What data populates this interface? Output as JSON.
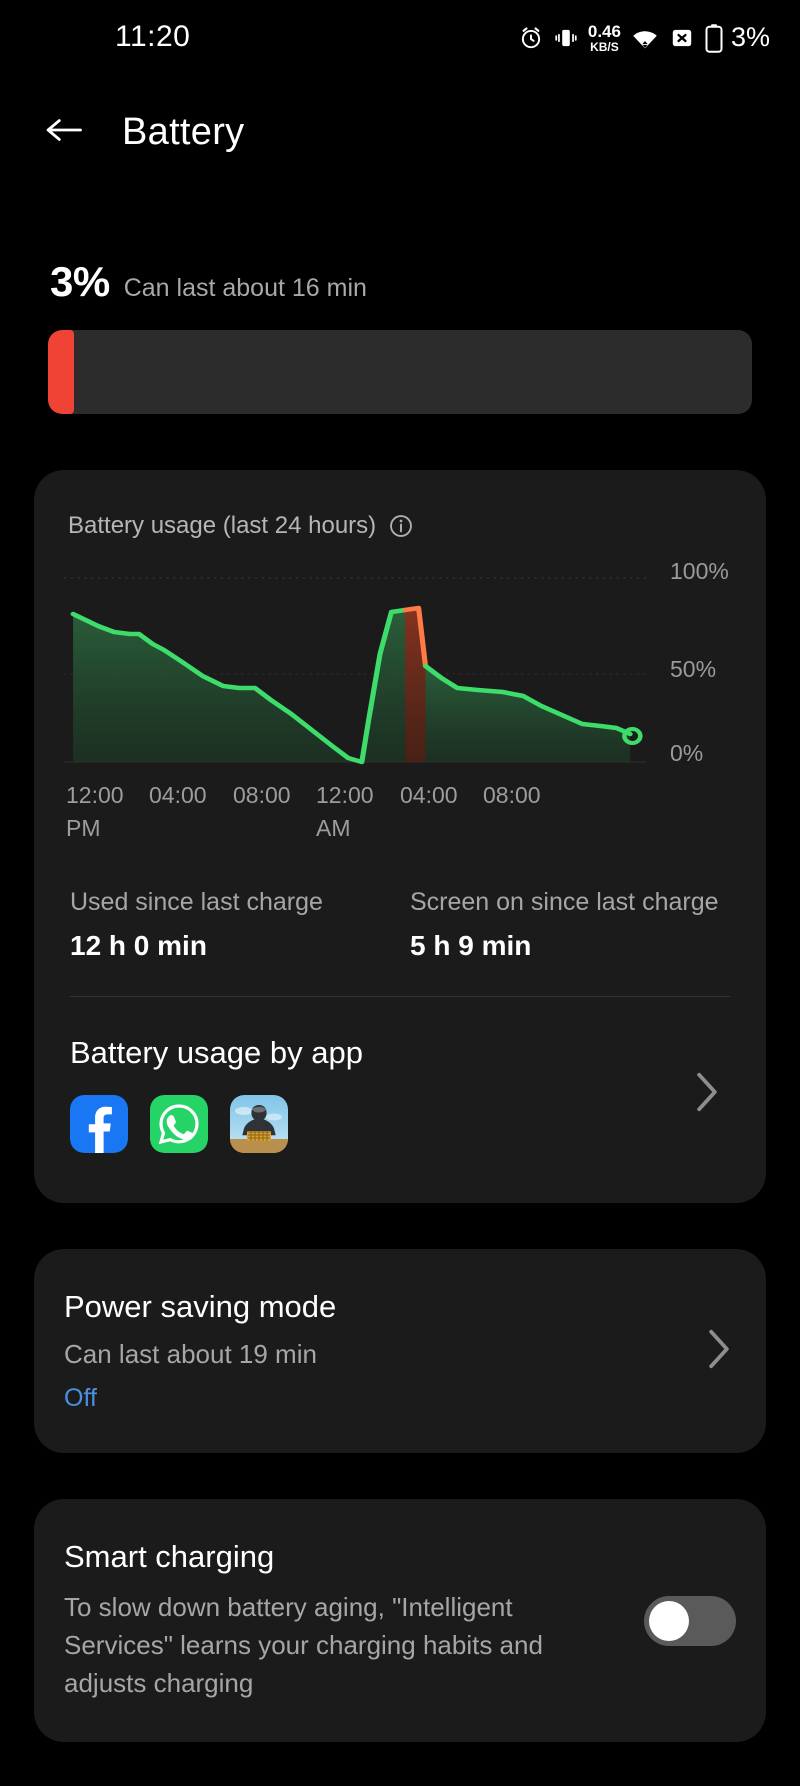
{
  "statusbar": {
    "time": "11:20",
    "netspeed_value": "0.46",
    "netspeed_unit": "KB/S",
    "battery_percent": "3%",
    "icons": [
      "alarm-icon",
      "vibrate-icon",
      "wifi-icon",
      "sim-disabled-icon",
      "battery-icon"
    ]
  },
  "appbar": {
    "back": "back-arrow-icon",
    "title": "Battery"
  },
  "summary": {
    "percent": "3%",
    "estimate": "Can last about 16 min",
    "bar_fill_percent": 3,
    "bar_fill_color": "#ef4335",
    "bar_track_color": "#2c2c2c"
  },
  "usage_card": {
    "title": "Battery usage (last 24 hours)",
    "info_icon": "info-icon",
    "stats": [
      {
        "label": "Used since last charge",
        "value": "12 h 0 min"
      },
      {
        "label": "Screen on since last charge",
        "value": "5 h 9 min"
      }
    ],
    "by_app": {
      "title": "Battery usage by app",
      "chevron": "chevron-right-icon",
      "apps": [
        "facebook-app-icon",
        "whatsapp-app-icon",
        "pubg-app-icon"
      ]
    }
  },
  "chart_data": {
    "type": "area",
    "title": "Battery usage (last 24 hours)",
    "xlabel": "",
    "ylabel": "",
    "ylim": [
      0,
      100
    ],
    "grid": true,
    "gridlines": [
      0,
      50,
      100
    ],
    "ytick_labels": [
      "100%",
      "50%",
      "0%"
    ],
    "ytick_values": [
      100,
      50,
      0
    ],
    "xtick_labels": [
      "12:00",
      "04:00",
      "08:00",
      "12:00",
      "04:00",
      "08:00"
    ],
    "xtick_sublabels": [
      "PM",
      "",
      "",
      "AM",
      "",
      ""
    ],
    "line_color": "#3ddc6b",
    "charging_color": "#ff6f3c",
    "fill_color": "#1f4a2c",
    "end_marker": "open-circle",
    "series": [
      {
        "name": "Battery level",
        "x": [
          0.0,
          1.0,
          1.6,
          2.2,
          2.6,
          3.2,
          3.6,
          4.4,
          5.2,
          6.0,
          6.6,
          7.2,
          7.8,
          8.6,
          9.4,
          10.2,
          10.8,
          11.3,
          11.6,
          11.9,
          12.3,
          12.8,
          13.3,
          13.7,
          14.1,
          14.6,
          15.2,
          15.9,
          16.6,
          17.4,
          18.2,
          19.0,
          19.8,
          20.6,
          21.4,
          22.2,
          23.0,
          23.6
        ],
        "values": [
          82,
          76,
          73,
          72,
          72,
          68,
          66,
          60,
          54,
          50,
          49,
          49,
          44,
          38,
          30,
          22,
          12,
          3,
          30,
          62,
          84,
          85,
          66,
          58,
          56,
          55,
          54,
          52,
          50,
          46,
          42,
          36,
          30,
          25,
          20,
          15,
          9,
          6
        ]
      }
    ],
    "charging_segment": {
      "x_start": 12.3,
      "x_end": 12.8,
      "note": "charging peak highlighted orange"
    }
  },
  "power_saving": {
    "title": "Power saving mode",
    "description": "Can last about 19 min",
    "state": "Off",
    "state_color": "#4a90e2",
    "chevron": "chevron-right-icon"
  },
  "smart_charging": {
    "title": "Smart charging",
    "description": "To slow down battery aging, \"Intelligent Services\" learns your charging habits and adjusts charging",
    "toggle_on": false
  }
}
